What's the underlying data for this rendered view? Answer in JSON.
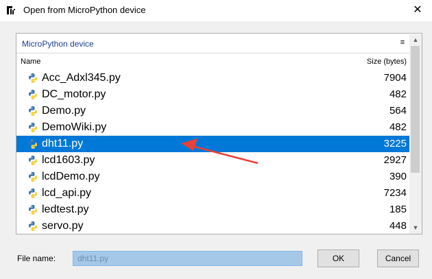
{
  "window": {
    "title": "Open from MicroPython device",
    "close_glyph": "✕"
  },
  "location": {
    "label": "MicroPython device",
    "menu_glyph": "≡"
  },
  "columns": {
    "name": "Name",
    "size": "Size (bytes)"
  },
  "files": [
    {
      "name": "Acc_Adxl345.py",
      "size": "7904",
      "selected": false
    },
    {
      "name": "DC_motor.py",
      "size": "482",
      "selected": false
    },
    {
      "name": "Demo.py",
      "size": "564",
      "selected": false
    },
    {
      "name": "DemoWiki.py",
      "size": "482",
      "selected": false
    },
    {
      "name": "dht11.py",
      "size": "3225",
      "selected": true
    },
    {
      "name": "lcd1603.py",
      "size": "2927",
      "selected": false
    },
    {
      "name": "lcdDemo.py",
      "size": "390",
      "selected": false
    },
    {
      "name": "lcd_api.py",
      "size": "7234",
      "selected": false
    },
    {
      "name": "ledtest.py",
      "size": "185",
      "selected": false
    },
    {
      "name": "servo.py",
      "size": "448",
      "selected": false
    }
  ],
  "scrollbar": {
    "up_glyph": "▲",
    "down_glyph": "▼"
  },
  "footer": {
    "filename_label": "File name:",
    "filename_value": "dht11.py",
    "ok_label": "OK",
    "cancel_label": "Cancel"
  },
  "colors": {
    "selection": "#0078d7",
    "location_text": "#1c3d8f",
    "annotation_arrow": "#e8413a",
    "python_blue": "#3b73a8",
    "python_yellow": "#f5cf3a"
  },
  "icons": {
    "app": "thonny-icon",
    "file": "python-file-icon"
  }
}
